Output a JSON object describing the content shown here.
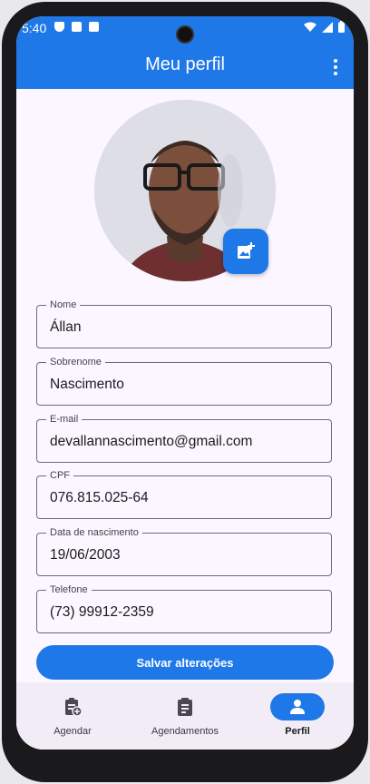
{
  "status_bar": {
    "time": "5:40"
  },
  "app_bar": {
    "title": "Meu perfil"
  },
  "profile": {
    "fields": [
      {
        "label": "Nome",
        "value": "Állan"
      },
      {
        "label": "Sobrenome",
        "value": "Nascimento"
      },
      {
        "label": "E-mail",
        "value": "devallannascimento@gmail.com"
      },
      {
        "label": "CPF",
        "value": "076.815.025-64"
      },
      {
        "label": "Data de nascimento",
        "value": "19/06/2003"
      },
      {
        "label": "Telefone",
        "value": "(73) 99912-2359"
      }
    ],
    "save_label": "Salvar alterações"
  },
  "bottom_nav": {
    "items": [
      {
        "label": "Agendar",
        "icon": "calendar-add-icon"
      },
      {
        "label": "Agendamentos",
        "icon": "clipboard-icon"
      },
      {
        "label": "Perfil",
        "icon": "person-icon",
        "active": true
      }
    ]
  },
  "colors": {
    "primary": "#1f78e8",
    "background": "#fbf6ff",
    "nav_background": "#f1ecf6"
  }
}
